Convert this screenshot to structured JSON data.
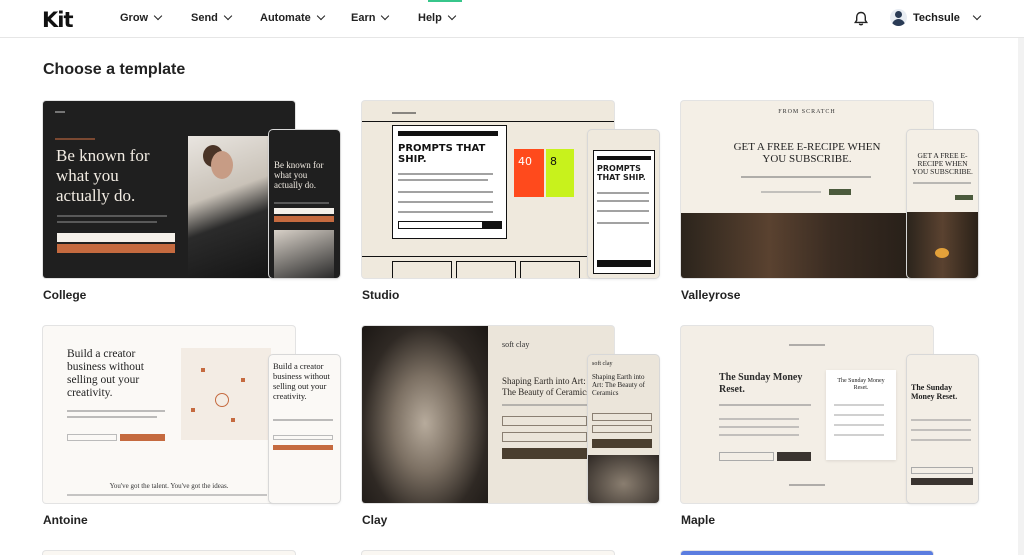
{
  "nav": {
    "logo": "Kit",
    "items": [
      {
        "label": "Grow"
      },
      {
        "label": "Send"
      },
      {
        "label": "Automate"
      },
      {
        "label": "Earn"
      },
      {
        "label": "Help"
      }
    ],
    "user": {
      "name": "Techsule"
    }
  },
  "page": {
    "title": "Choose a template"
  },
  "templates": [
    {
      "name": "College",
      "preview": {
        "headline": "Be known for what you actually do.",
        "mobile_headline": "Be known for what you actually do."
      }
    },
    {
      "name": "Studio",
      "preview": {
        "headline": "PROMPTS THAT SHIP.",
        "tile_a": "40",
        "tile_b": "8"
      }
    },
    {
      "name": "Valleyrose",
      "preview": {
        "brand": "FROM SCRATCH",
        "headline": "GET A FREE E-RECIPE WHEN YOU SUBSCRIBE.",
        "mobile_headline": "GET A FREE E-RECIPE WHEN YOU SUBSCRIBE."
      }
    },
    {
      "name": "Antoine",
      "preview": {
        "headline": "Build a creator business without selling out your creativity.",
        "tagline": "You've got the talent. You've got the ideas."
      }
    },
    {
      "name": "Clay",
      "preview": {
        "brand": "soft clay",
        "headline": "Shaping Earth into Art: The Beauty of Ceramics"
      }
    },
    {
      "name": "Maple",
      "preview": {
        "headline": "The Sunday Money Reset.",
        "mobile_headline": "The Sunday Money Reset."
      }
    }
  ],
  "colors": {
    "college_bg": "#1f1f1f",
    "college_accent": "#c56a3f",
    "studio_red": "#ff4a1c",
    "studio_lime": "#c8f21c",
    "page_bg": "#ffffff",
    "active_indicator": "#37c68b"
  },
  "icons": {
    "notifications": "bell-icon",
    "user": "avatar",
    "dropdown": "chevron-down-icon"
  }
}
